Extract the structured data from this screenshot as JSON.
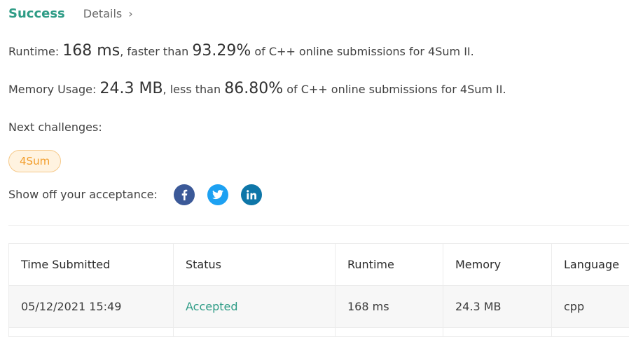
{
  "header": {
    "status": "Success",
    "details_label": "Details",
    "details_chevron": "›"
  },
  "runtime": {
    "label": "Runtime: ",
    "value": "168 ms",
    "middle": ", faster than ",
    "percent": "93.29%",
    "suffix": " of C++ online submissions for 4Sum II."
  },
  "memory": {
    "label": "Memory Usage: ",
    "value": "24.3 MB",
    "middle": ", less than ",
    "percent": "86.80%",
    "suffix": " of C++ online submissions for 4Sum II."
  },
  "next_challenges": {
    "label": "Next challenges:",
    "items": [
      "4Sum"
    ]
  },
  "share": {
    "label": "Show off your acceptance:",
    "icons": [
      "facebook-icon",
      "twitter-icon",
      "linkedin-icon"
    ],
    "colors": {
      "facebook": "#3b5998",
      "twitter": "#1da1f2",
      "linkedin": "#0e76a8"
    }
  },
  "table": {
    "columns": [
      "Time Submitted",
      "Status",
      "Runtime",
      "Memory",
      "Language"
    ],
    "rows": [
      [
        "05/12/2021 15:49",
        "Accepted",
        "168 ms",
        "24.3 MB",
        "cpp"
      ]
    ]
  },
  "colors": {
    "accent": "#2e9c86",
    "tag_text": "#f29d2a",
    "tag_bg": "#fff3e0"
  }
}
